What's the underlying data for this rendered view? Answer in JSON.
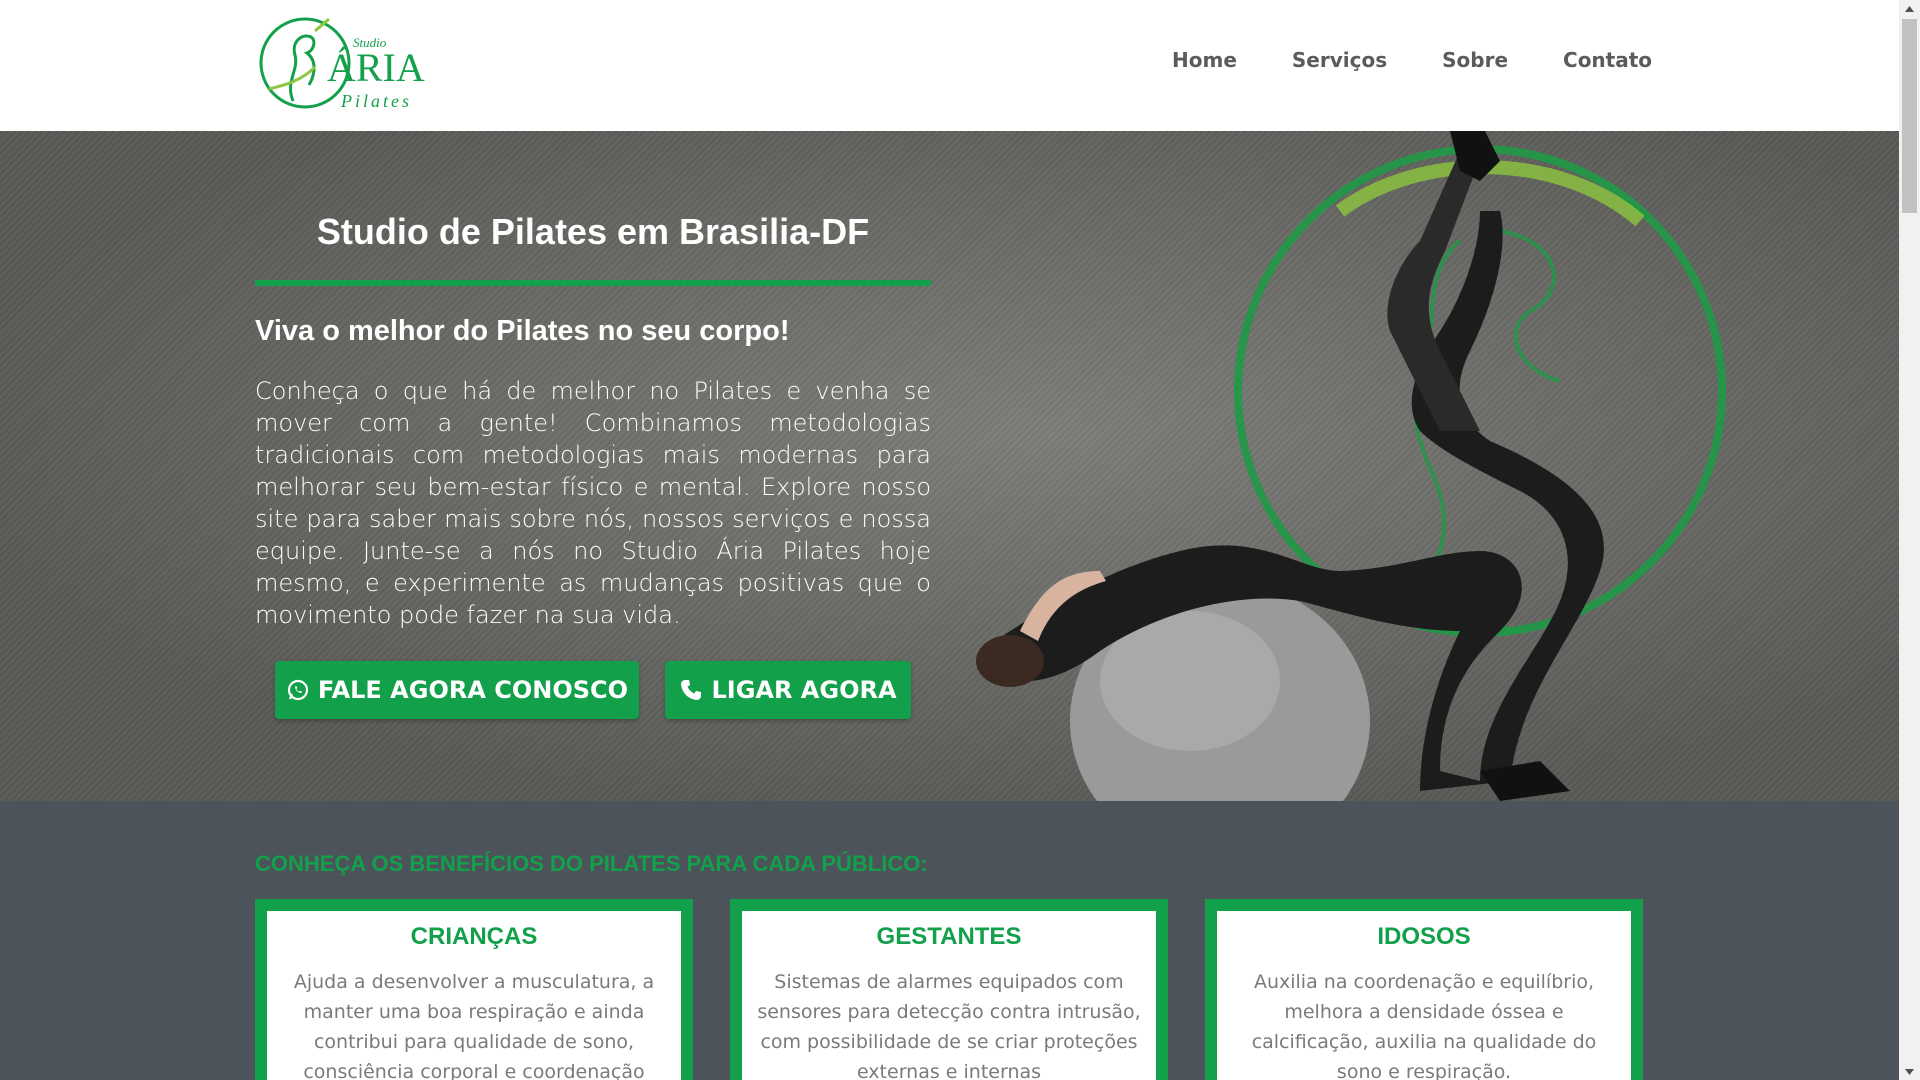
{
  "brand": {
    "logo_alt": "Studio Ária Pilates",
    "logo_studio": "Studio",
    "logo_aria": "ÁRIA",
    "logo_pilates": "Pilates"
  },
  "nav": {
    "items": [
      {
        "label": "Home"
      },
      {
        "label": "Serviços"
      },
      {
        "label": "Sobre"
      },
      {
        "label": "Contato"
      }
    ]
  },
  "hero": {
    "title": "Studio de Pilates em Brasilia-DF",
    "subtitle": "Viva o melhor do Pilates no seu corpo!",
    "text": "Conheça o que há de melhor no Pilates e venha se mover com a gente! Combinamos metodologias tradicionais com metodologias mais modernas para melhorar seu bem-estar físico e mental. Explore nosso site para saber mais sobre nós, nossos serviços e nossa equipe. Junte-se a nós no Studio Ária Pilates hoje mesmo, e experimente as mudanças positivas que o movimento pode fazer na sua vida.",
    "buttons": {
      "whatsapp_label": "FALE AGORA CONOSCO",
      "whatsapp_icon": "whatsapp-icon",
      "call_label": "LIGAR AGORA",
      "call_icon": "phone-icon"
    }
  },
  "benefits": {
    "title": "CONHEÇA OS BENEFÍCIOS DO PILATES PARA CADA PÚBLICO:",
    "cards": [
      {
        "title": "CRIANÇAS",
        "text": "Ajuda a desenvolver a musculatura, a manter uma boa respiração e ainda contribui para qualidade de sono, consciência corporal e coordenação"
      },
      {
        "title": "GESTANTES",
        "text": "Sistemas de alarmes equipados com sensores para detecção contra intrusão, com possibilidade de se criar proteções externas e internas"
      },
      {
        "title": "IDOSOS",
        "text": "Auxilia na coordenação e equilíbrio, melhora a densidade óssea e calcificação, auxilia na qualidade do sono e respiração."
      }
    ]
  },
  "colors": {
    "accent": "#13a04a",
    "dark_section": "#4d535a",
    "nav_text": "#5b5b5b"
  }
}
